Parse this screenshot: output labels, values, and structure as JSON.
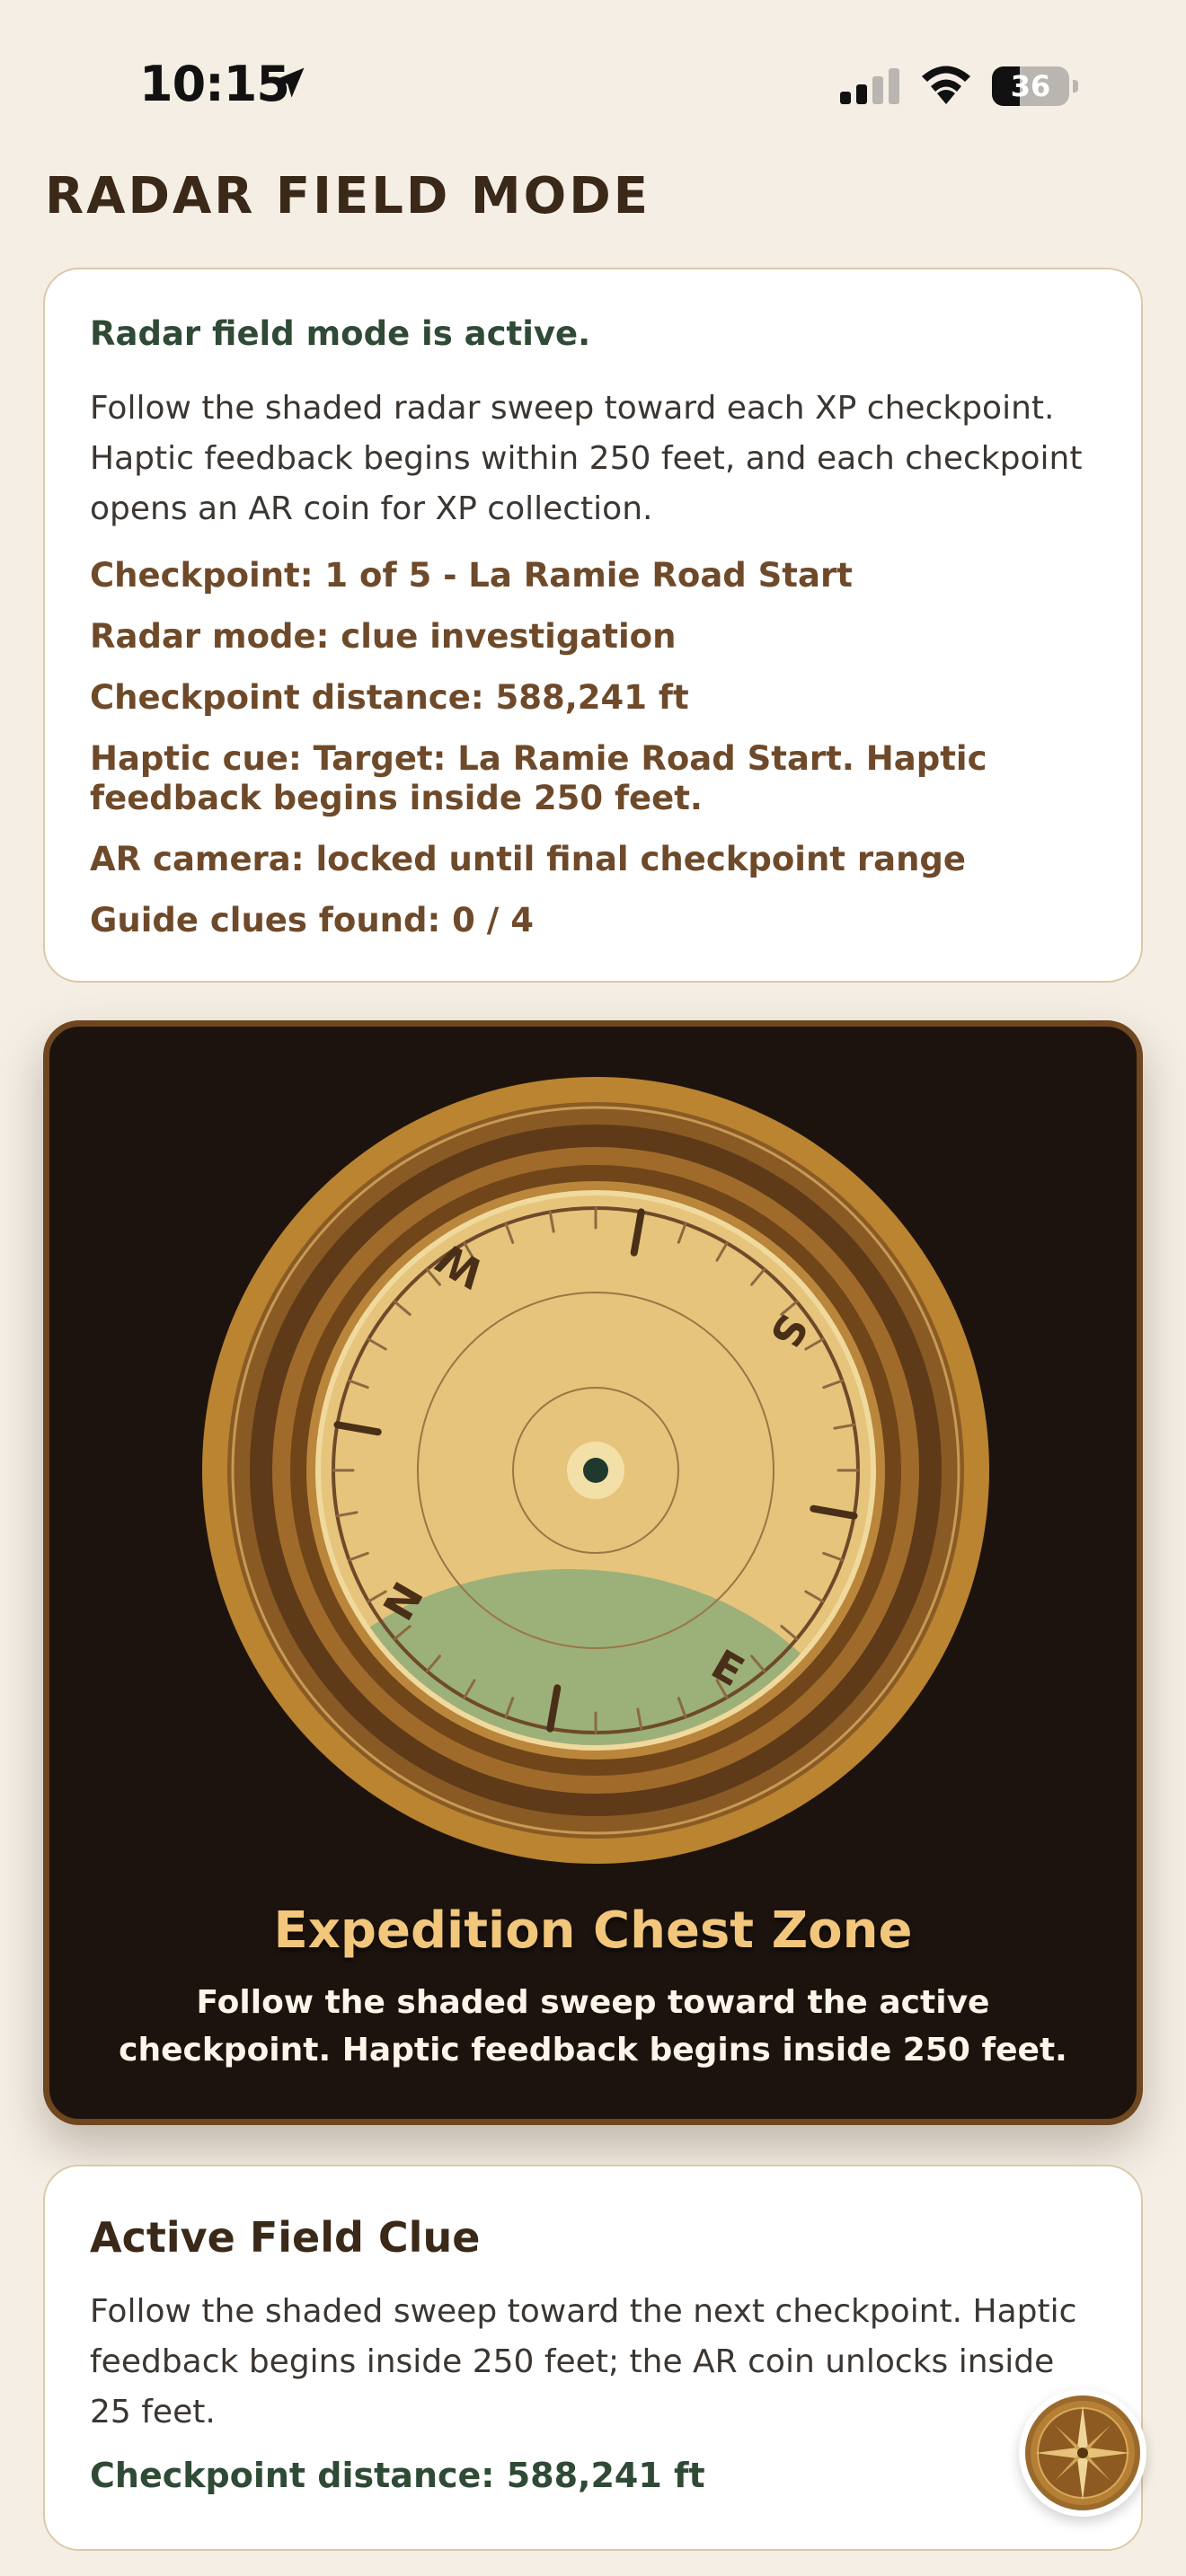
{
  "status_bar": {
    "time": "10:15",
    "battery_level": "36",
    "battery_fraction": 0.36,
    "icons": [
      "location-arrow-icon",
      "cellular-signal-icon",
      "wifi-icon",
      "battery-icon"
    ]
  },
  "page": {
    "title": "RADAR FIELD MODE"
  },
  "status_card": {
    "headline": "Radar field mode is active.",
    "description": "Follow the shaded radar sweep toward each XP checkpoint. Haptic feedback begins within 250 feet, and each checkpoint opens an AR coin for XP collection.",
    "details": [
      "Checkpoint: 1 of 5 - La Ramie Road Start",
      "Radar mode: clue investigation",
      "Checkpoint distance: 588,241 ft",
      "Haptic cue: Target: La Ramie Road Start. Haptic feedback begins inside 250 feet.",
      "AR camera: locked until final checkpoint range",
      "Guide clues found: 0 / 4"
    ]
  },
  "radar": {
    "letters": [
      "N",
      "E",
      "S",
      "W"
    ],
    "zone_title": "Expedition Chest Zone",
    "zone_description": "Follow the shaded sweep toward the active checkpoint. Haptic feedback begins inside 250 feet.",
    "colors": {
      "panel": "#1d130e",
      "dial": "#e6c47c",
      "sweep": "#9cb07a",
      "rim": "#b98330",
      "zone_title": "#f2c77c"
    }
  },
  "clue_card": {
    "title": "Active Field Clue",
    "description": "Follow the shaded sweep toward the next checkpoint. Haptic feedback begins inside 250 feet; the AR coin unlocks inside 25 feet.",
    "distance": "Checkpoint distance: 588,241 ft"
  },
  "fab": {
    "icon": "compass-rose-icon"
  }
}
